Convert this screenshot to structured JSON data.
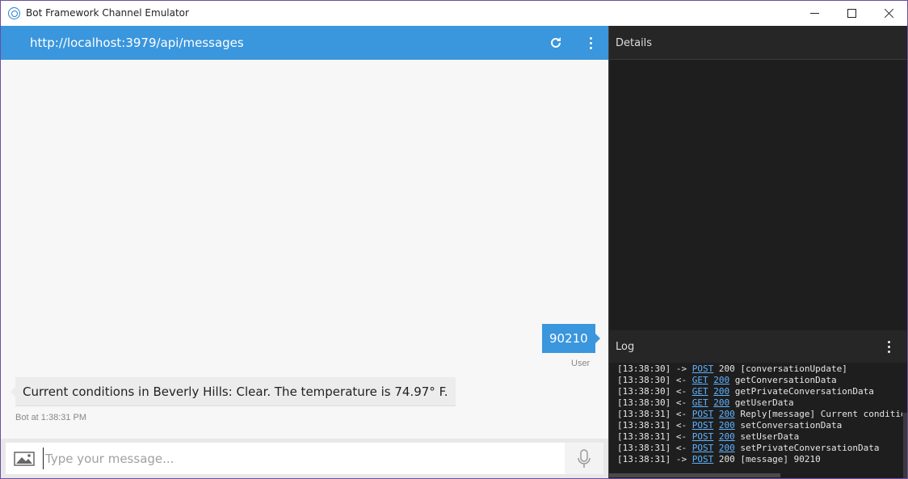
{
  "window": {
    "title": "Bot Framework Channel Emulator",
    "icons": {
      "app": "bot-emulator-icon",
      "minimize": "minimize-icon",
      "maximize": "maximize-icon",
      "close": "close-icon"
    }
  },
  "chat": {
    "endpoint_url": "http://localhost:3979/api/messages",
    "header_icons": {
      "refresh": "refresh-icon",
      "menu": "more-vertical-icon"
    },
    "messages": [
      {
        "from": "user",
        "text": "90210",
        "meta": "User"
      },
      {
        "from": "bot",
        "text": "Current conditions in Beverly Hills: Clear. The temperature is 74.97° F.",
        "meta": "Bot at 1:38:31 PM"
      }
    ],
    "composer": {
      "placeholder": "Type your message...",
      "upload_icon": "image-upload-icon",
      "mic_icon": "microphone-icon"
    }
  },
  "inspector": {
    "details_title": "Details",
    "log_title": "Log",
    "log_menu_icon": "more-vertical-icon",
    "log": [
      {
        "time": "[13:38:30]",
        "dir": "->",
        "method": "POST",
        "status": "200",
        "status_link": false,
        "text": "[conversationUpdate]"
      },
      {
        "time": "[13:38:30]",
        "dir": "<-",
        "method": "GET",
        "status": "200",
        "status_link": true,
        "text": "getConversationData"
      },
      {
        "time": "[13:38:30]",
        "dir": "<-",
        "method": "GET",
        "status": "200",
        "status_link": true,
        "text": "getPrivateConversationData"
      },
      {
        "time": "[13:38:30]",
        "dir": "<-",
        "method": "GET",
        "status": "200",
        "status_link": true,
        "text": "getUserData"
      },
      {
        "time": "[13:38:31]",
        "dir": "<-",
        "method": "POST",
        "status": "200",
        "status_link": true,
        "text": "Reply[message] Current conditio"
      },
      {
        "time": "[13:38:31]",
        "dir": "<-",
        "method": "POST",
        "status": "200",
        "status_link": true,
        "text": "setConversationData"
      },
      {
        "time": "[13:38:31]",
        "dir": "<-",
        "method": "POST",
        "status": "200",
        "status_link": true,
        "text": "setUserData"
      },
      {
        "time": "[13:38:31]",
        "dir": "<-",
        "method": "POST",
        "status": "200",
        "status_link": true,
        "text": "setPrivateConversationData"
      },
      {
        "time": "[13:38:31]",
        "dir": "->",
        "method": "POST",
        "status": "200",
        "status_link": false,
        "text": "[message] 90210"
      }
    ]
  },
  "colors": {
    "accent": "#3a96dd",
    "panel_dark": "#1e1e1e",
    "log_link": "#5fb3ff",
    "bot_bubble": "#ececec"
  }
}
